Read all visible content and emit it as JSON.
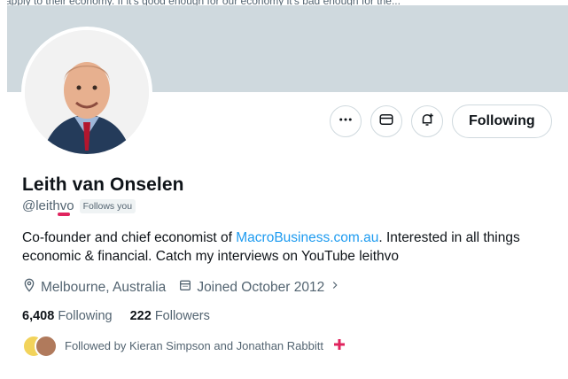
{
  "page_top_text": "apply to their economy. If it's good enough for our economy it's bad enough for the...",
  "profile": {
    "name": "Leith van Onselen",
    "handle": "@leithvo",
    "follows_you_badge": "Follows you",
    "bio_prefix": "Co-founder and chief economist of ",
    "bio_link": "MacroBusiness.com.au",
    "bio_suffix": ". Interested in all things economic & financial. Catch my interviews on YouTube leithvo",
    "location": "Melbourne, Australia",
    "joined": "Joined October 2012",
    "following_count": "6,408",
    "following_label": "Following",
    "followers_count": "222",
    "followers_label": "Followers",
    "followed_by": "Followed by Kieran Simpson and Jonathan Rabbitt"
  },
  "actions": {
    "more_icon": "more-icon",
    "message_icon": "message-icon",
    "notify_icon": "notification-bell-icon",
    "follow_label": "Following"
  },
  "colors": {
    "banner": "#cfd9de",
    "link": "#1d9bf0",
    "secondary_text": "#536471"
  }
}
